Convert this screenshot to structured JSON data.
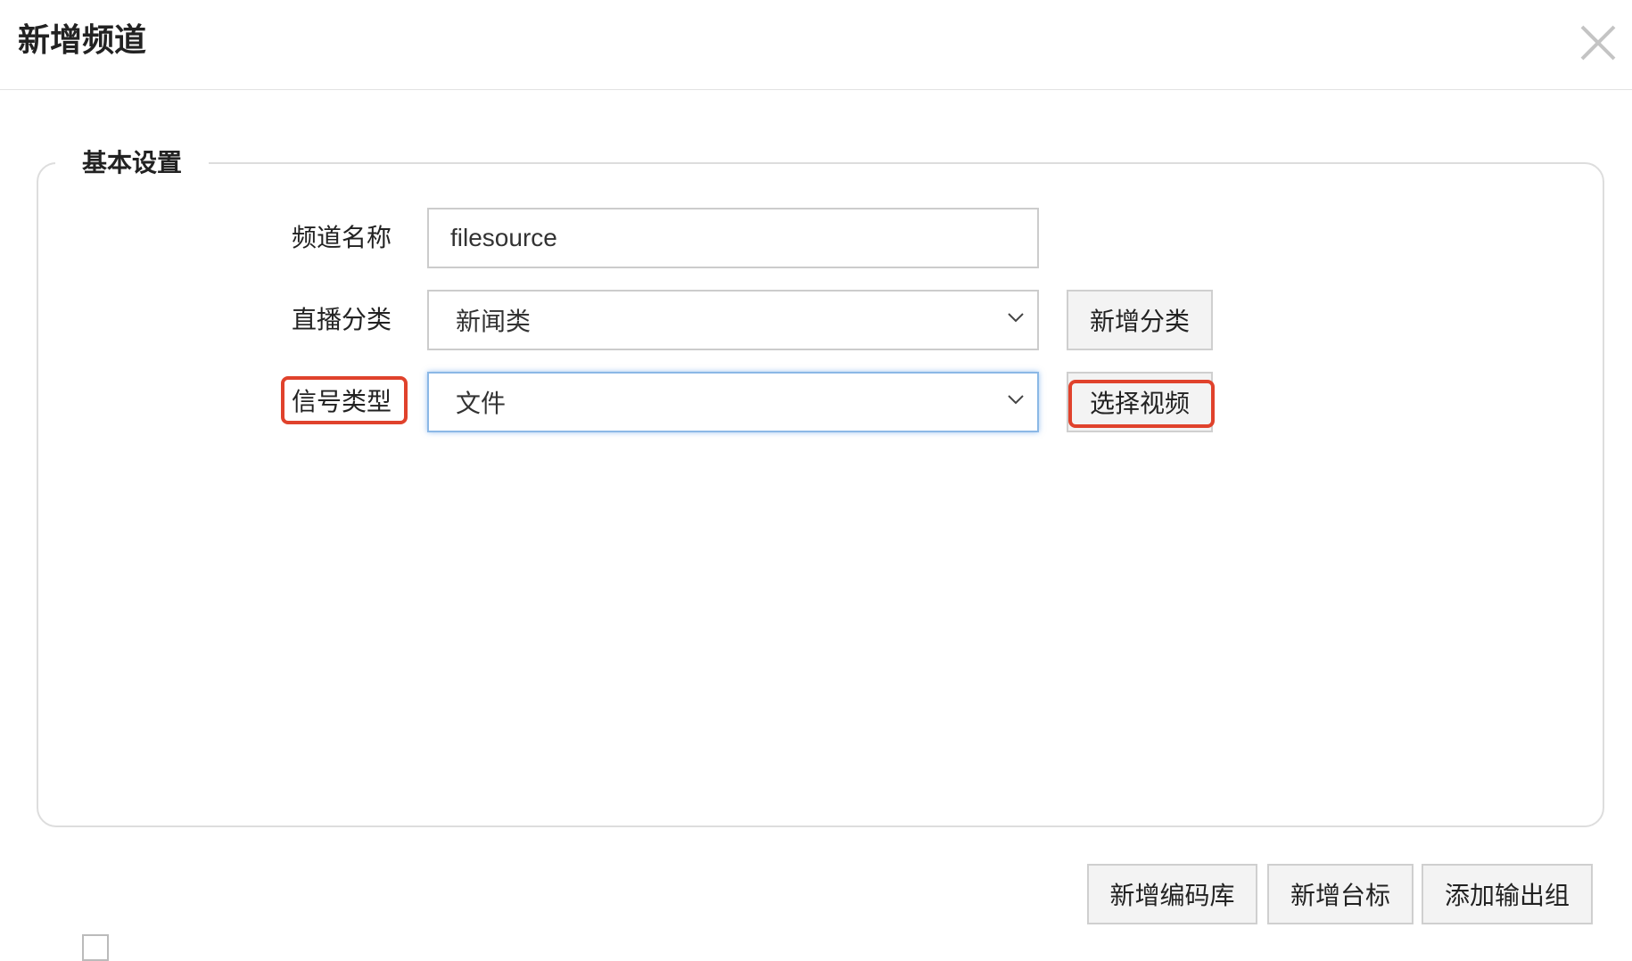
{
  "dialog": {
    "title": "新增频道",
    "close_icon": "close-icon"
  },
  "basic_settings": {
    "legend": "基本设置",
    "channel_name": {
      "label": "频道名称",
      "value": "filesource"
    },
    "live_category": {
      "label": "直播分类",
      "selected": "新闻类",
      "add_button": "新增分类"
    },
    "signal_type": {
      "label": "信号类型",
      "selected": "文件",
      "action_button": "选择视频"
    }
  },
  "footer": {
    "add_encoder_lib": "新增编码库",
    "add_station_logo": "新增台标",
    "add_output_group": "添加输出组"
  },
  "colors": {
    "highlight": "#e0422c",
    "focus_border": "#8bb8e6"
  }
}
